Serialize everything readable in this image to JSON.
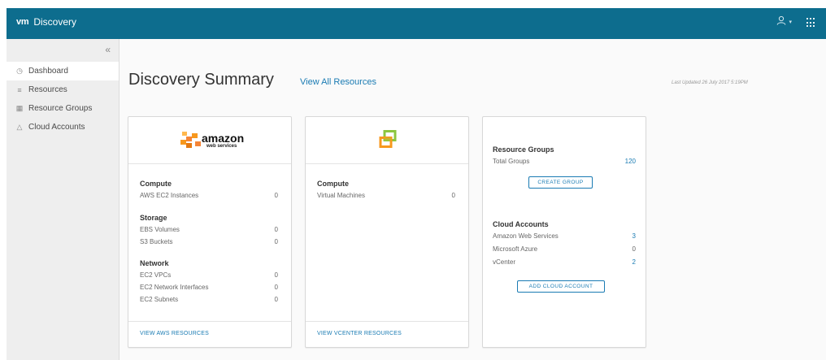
{
  "app": {
    "logo": "vm",
    "title": "Discovery"
  },
  "sidebar": {
    "collapse_glyph": "«",
    "items": [
      {
        "label": "Dashboard",
        "icon": "dashboard-icon",
        "glyph": "◷",
        "active": true
      },
      {
        "label": "Resources",
        "icon": "list-icon",
        "glyph": "≡"
      },
      {
        "label": "Resource Groups",
        "icon": "grid-icon",
        "glyph": "▦"
      },
      {
        "label": "Cloud Accounts",
        "icon": "cloud-icon",
        "glyph": "△"
      }
    ]
  },
  "main": {
    "title": "Discovery Summary",
    "view_all": "View All Resources",
    "last_updated": "Last Updated 26 July 2017 5:19PM"
  },
  "aws_card": {
    "logo_text": "amazon",
    "logo_sub": "web services",
    "sections": [
      {
        "title": "Compute",
        "rows": [
          {
            "label": "AWS EC2 Instances",
            "value": "0"
          }
        ]
      },
      {
        "title": "Storage",
        "rows": [
          {
            "label": "EBS Volumes",
            "value": "0"
          },
          {
            "label": "S3 Buckets",
            "value": "0"
          }
        ]
      },
      {
        "title": "Network",
        "rows": [
          {
            "label": "EC2 VPCs",
            "value": "0"
          },
          {
            "label": "EC2 Network Interfaces",
            "value": "0"
          },
          {
            "label": "EC2 Subnets",
            "value": "0"
          }
        ]
      }
    ],
    "footer_link": "VIEW AWS RESOURCES"
  },
  "vcenter_card": {
    "sections": [
      {
        "title": "Compute",
        "rows": [
          {
            "label": "Virtual Machines",
            "value": "0"
          }
        ]
      }
    ],
    "footer_link": "VIEW VCENTER RESOURCES"
  },
  "summary_card": {
    "resource_groups": {
      "title": "Resource Groups",
      "rows": [
        {
          "label": "Total Groups",
          "value": "120"
        }
      ],
      "button": "CREATE GROUP"
    },
    "cloud_accounts": {
      "title": "Cloud Accounts",
      "rows": [
        {
          "label": "Amazon Web Services",
          "value": "3"
        },
        {
          "label": "Microsoft Azure",
          "value": "0"
        },
        {
          "label": "vCenter",
          "value": "2"
        }
      ],
      "button": "ADD CLOUD ACCOUNT"
    }
  },
  "colors": {
    "header": "#0d6d8e",
    "link": "#1a7bb3",
    "sidebar": "#eeeeee",
    "aws_orange": "#f7981d",
    "vcenter_green": "#8dc63f"
  }
}
